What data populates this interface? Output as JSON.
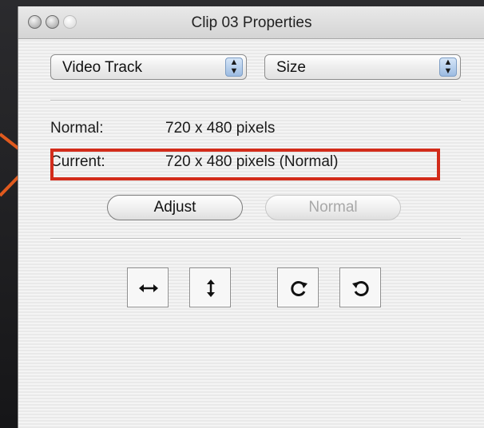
{
  "window": {
    "title": "Clip 03 Properties"
  },
  "popups": {
    "track": "Video Track",
    "property": "Size"
  },
  "info": {
    "normal_label": "Normal:",
    "normal_value": "720 x 480 pixels",
    "current_label": "Current:",
    "current_value": "720 x 480 pixels (Normal)"
  },
  "buttons": {
    "adjust": "Adjust",
    "normal": "Normal"
  },
  "tools": [
    {
      "icon": "flip-horizontal-icon"
    },
    {
      "icon": "flip-vertical-icon"
    },
    {
      "icon": "rotate-clockwise-icon"
    },
    {
      "icon": "rotate-counterclockwise-icon"
    }
  ],
  "colors": {
    "highlight": "#d22c1b",
    "annotation": "#e05a1e"
  }
}
